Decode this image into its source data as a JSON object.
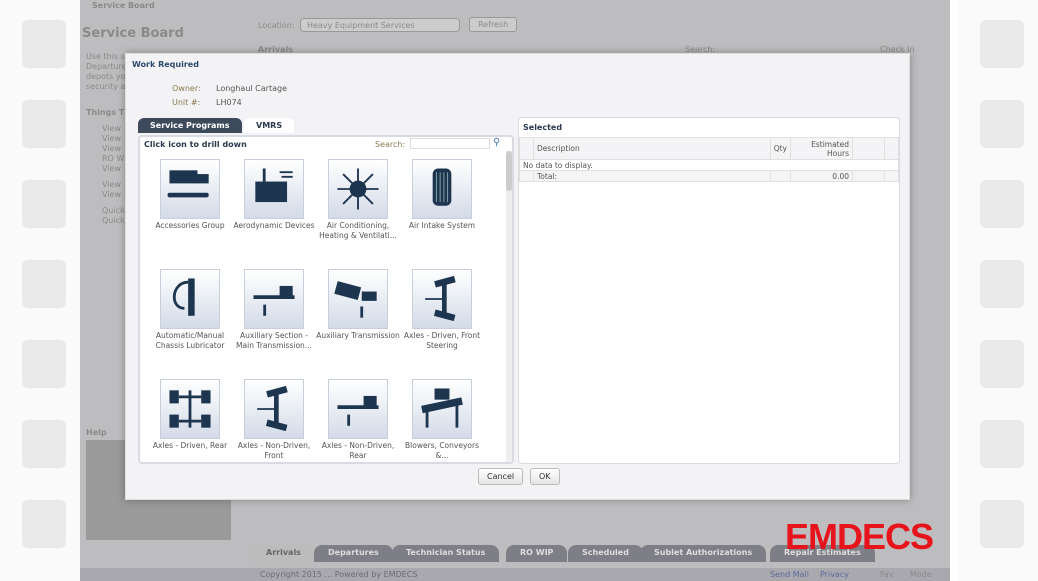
{
  "app": {
    "breadcrumb": "Service Board",
    "title": "Service Board",
    "location_label": "Location:",
    "location_value": "Heavy Equipment Services",
    "refresh": "Refresh",
    "arrivals": "Arrivals",
    "search": "Search:",
    "check_in": "Check In",
    "intro": [
      "Use this s",
      "Departure",
      "depots yo",
      "security a"
    ],
    "things_title": "Things T",
    "links": [
      "View",
      "View",
      "View",
      "RO W",
      "View",
      "View",
      "View",
      "Quick",
      "Quick"
    ],
    "help": "Help",
    "bottom_tabs": [
      "Arrivals",
      "Departures",
      "Technician Status",
      "RO WIP",
      "Scheduled",
      "Sublet Authorizations",
      "Repair Estimates"
    ],
    "footer": "Copyright 2015 ... Powered by EMDECS",
    "footer_links": [
      "Send Mail",
      "Privacy",
      "Fav",
      "Mode"
    ]
  },
  "modal": {
    "title": "Work Required",
    "owner_label": "Owner:",
    "owner": "Longhaul Cartage",
    "unit_label": "Unit #:",
    "unit": "LH074",
    "tabs": [
      "Service Programs",
      "VMRS"
    ],
    "drill": "Click icon to drill down",
    "search_label": "Search:",
    "search_value": "",
    "items": [
      {
        "label": "Accessories Group",
        "icon": "van-wrench-icon"
      },
      {
        "label": "Aerodynamic Devices",
        "icon": "truck-airflow-icon"
      },
      {
        "label": "Air Conditioning, Heating & Ventilati...",
        "icon": "snowflake-sun-icon"
      },
      {
        "label": "Air Intake System",
        "icon": "air-filter-icon"
      },
      {
        "label": "Automatic/Manual Chassis Lubricator",
        "icon": "grease-gun-icon"
      },
      {
        "label": "Auxiliary Section - Main Transmission...",
        "icon": "tractor-arrow-icon"
      },
      {
        "label": "Auxiliary Transmission",
        "icon": "dump-truck-icon"
      },
      {
        "label": "Axles - Driven, Front Steering",
        "icon": "axle-icon"
      },
      {
        "label": "Axles - Driven, Rear",
        "icon": "axle-chassis-icon"
      },
      {
        "label": "Axles - Non-Driven, Front",
        "icon": "axle-icon"
      },
      {
        "label": "Axles - Non-Driven, Rear",
        "icon": "tractor-arrow-icon"
      },
      {
        "label": "Blowers, Conveyors &...",
        "icon": "conveyor-icon"
      }
    ],
    "selected_title": "Selected",
    "columns": [
      "Description",
      "Qty",
      "Estimated Hours"
    ],
    "empty": "No data to display.",
    "total_label": "Total:",
    "total": "0.00",
    "cancel": "Cancel",
    "ok": "OK"
  },
  "brand": "EMDECS",
  "brand_color": "#e8141c"
}
